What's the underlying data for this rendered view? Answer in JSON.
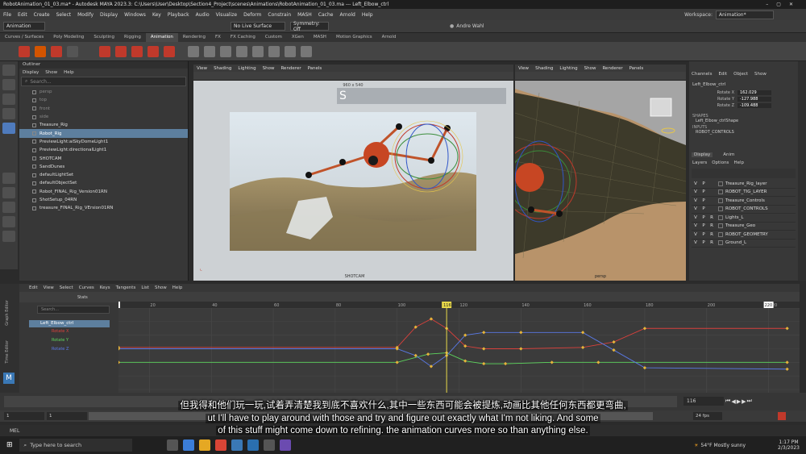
{
  "window": {
    "title": "RobotAnimation_01_03.ma* - Autodesk MAYA 2023.3: C:\\Users\\User\\Desktop\\Section4_Project\\scenes\\Animations\\RobotAnimation_01_03.ma --- Left_Elbow_ctrl",
    "workspace_label": "Workspace:",
    "workspace_value": "Animation*"
  },
  "menu": [
    "File",
    "Edit",
    "Create",
    "Select",
    "Modify",
    "Display",
    "Windows",
    "Key",
    "Playback",
    "Audio",
    "Visualize",
    "Deform",
    "Constrain",
    "MASH",
    "Cache",
    "Arnold",
    "Help"
  ],
  "status_line": {
    "mode": "Animation",
    "live_surface": "No Live Surface",
    "symmetry": "Symmetry: Off",
    "user": "Andre Wahl"
  },
  "shelf_tabs": [
    "Curves / Surfaces",
    "Poly Modeling",
    "Sculpting",
    "Rigging",
    "Animation",
    "Rendering",
    "FX",
    "FX Caching",
    "Custom",
    "XGen",
    "MASH",
    "Motion Graphics",
    "Arnold"
  ],
  "shelf_active": "Animation",
  "outliner": {
    "title": "Outliner",
    "menu": [
      "Display",
      "Show",
      "Help"
    ],
    "search_placeholder": "Search...",
    "items": [
      {
        "label": "persp",
        "dim": true
      },
      {
        "label": "top",
        "dim": true
      },
      {
        "label": "front",
        "dim": true
      },
      {
        "label": "side",
        "dim": true
      },
      {
        "label": "Treasure_Rig",
        "dim": false
      },
      {
        "label": "Robot_Rig",
        "dim": false,
        "selected": true
      },
      {
        "label": "PreviewLight:aiSkyDomeLight1",
        "dim": false
      },
      {
        "label": "PreviewLight:directionalLight1",
        "dim": false
      },
      {
        "label": "SHOTCAM",
        "dim": false
      },
      {
        "label": "SandDunes",
        "dim": false
      },
      {
        "label": "defaultLightSet",
        "dim": false
      },
      {
        "label": "defaultObjectSet",
        "dim": false
      },
      {
        "label": "Robot_FINAL_Rig_Version01RN",
        "dim": false
      },
      {
        "label": "ShotSetup_04RN",
        "dim": false
      },
      {
        "label": "treasure_FINAL_Rig_VErsion01RN",
        "dim": false
      }
    ]
  },
  "viewport1": {
    "menu": [
      "View",
      "Shading",
      "Lighting",
      "Show",
      "Renderer",
      "Panels"
    ],
    "resolution": "960 x 540",
    "camera": "SHOTCAM"
  },
  "viewport2": {
    "menu": [
      "View",
      "Shading",
      "Lighting",
      "Show",
      "Renderer",
      "Panels"
    ],
    "camera": "persp"
  },
  "channel_box": {
    "menu": [
      "Channels",
      "Edit",
      "Object",
      "Show"
    ],
    "object": "Left_Elbow_ctrl",
    "channels": [
      {
        "name": "Rotate X",
        "value": "162.029"
      },
      {
        "name": "Rotate Y",
        "value": "-127.988"
      },
      {
        "name": "Rotate Z",
        "value": "-109.488"
      }
    ],
    "shapes_label": "SHAPES",
    "shape": "Left_Elbow_ctrlShape",
    "inputs_label": "INPUTS",
    "input": "ROBOT_CONTROLS",
    "tabs": [
      "Display",
      "Anim"
    ],
    "layer_menu": [
      "Layers",
      "Options",
      "Help"
    ],
    "layers": [
      {
        "v": "V",
        "p": "P",
        "r": "",
        "name": "Treasure_Rig_layer"
      },
      {
        "v": "V",
        "p": "P",
        "r": "",
        "name": "ROBOT_TIG_LAYER"
      },
      {
        "v": "V",
        "p": "P",
        "r": "",
        "name": "Treasure_Controls"
      },
      {
        "v": "V",
        "p": "P",
        "r": "",
        "name": "ROBOT_CONTROLS"
      },
      {
        "v": "V",
        "p": "P",
        "r": "R",
        "name": "Lights_L"
      },
      {
        "v": "V",
        "p": "P",
        "r": "R",
        "name": "Treasure_Geo"
      },
      {
        "v": "V",
        "p": "P",
        "r": "R",
        "name": "ROBOT_GEOMETRY"
      },
      {
        "v": "V",
        "p": "P",
        "r": "R",
        "name": "Ground_L"
      }
    ]
  },
  "graph_editor": {
    "side_labels": [
      "Graph Editor",
      "Time Editor"
    ],
    "menu": [
      "Edit",
      "View",
      "Select",
      "Curves",
      "Keys",
      "Tangents",
      "List",
      "Show",
      "Help"
    ],
    "stats_label": "Stats",
    "search_placeholder": "Search...",
    "node": "Left_Elbow_ctrl",
    "curves": [
      {
        "name": "Rotate X",
        "color": "#d9413c"
      },
      {
        "name": "Rotate Y",
        "color": "#5ed65e"
      },
      {
        "name": "Rotate Z",
        "color": "#5a7ae8"
      }
    ],
    "current_frame": "116",
    "range_end": "220",
    "x_ticks": [
      "20",
      "40",
      "60",
      "80",
      "100",
      "120",
      "140",
      "160",
      "180",
      "200",
      "220"
    ],
    "y_ticks": [
      "300",
      "200",
      "100",
      "0",
      "-100",
      "-200",
      "-300"
    ]
  },
  "chart_data": {
    "type": "line",
    "title": "",
    "xlabel": "",
    "ylabel": "",
    "xlim": [
      10,
      230
    ],
    "ylim": [
      -300,
      300
    ],
    "series": [
      {
        "name": "Rotate X",
        "color": "#d9413c",
        "x": [
          10,
          100,
          106,
          111,
          116,
          122,
          128,
          140,
          160,
          170,
          180,
          226
        ],
        "y": [
          10,
          10,
          160,
          220,
          150,
          20,
          0,
          0,
          10,
          50,
          150,
          150
        ]
      },
      {
        "name": "Rotate Y",
        "color": "#5ed65e",
        "x": [
          10,
          100,
          110,
          116,
          122,
          128,
          135,
          150,
          165,
          226
        ],
        "y": [
          -100,
          -100,
          -40,
          -30,
          -90,
          -110,
          -110,
          -100,
          -100,
          -100
        ]
      },
      {
        "name": "Rotate Z",
        "color": "#5a7ae8",
        "x": [
          10,
          100,
          106,
          111,
          116,
          122,
          128,
          140,
          160,
          170,
          180,
          226
        ],
        "y": [
          0,
          0,
          -50,
          -130,
          -50,
          100,
          120,
          120,
          120,
          -10,
          -140,
          -150
        ]
      }
    ]
  },
  "timeline": {
    "frame_field": "116",
    "range_start": "1",
    "range_start2": "1",
    "range_end": "220",
    "fps": "24 fps"
  },
  "mel_label": "MEL",
  "subtitles": {
    "zh": "但我得和他们玩一玩,试着弄清楚我到底不喜欢什么,其中一些东西可能会被提炼,动画比其他任何东西都更弯曲,",
    "en1": "ut I'll have to play around with those and try and figure out exactly what I'm not liking. And some",
    "en2": "of this stuff might come down to refining. the animation curves more so than anything else."
  },
  "taskbar": {
    "search": "Type here to search",
    "weather": "54°F  Mostly sunny",
    "time": "1:17 PM",
    "date": "2/3/2023"
  }
}
